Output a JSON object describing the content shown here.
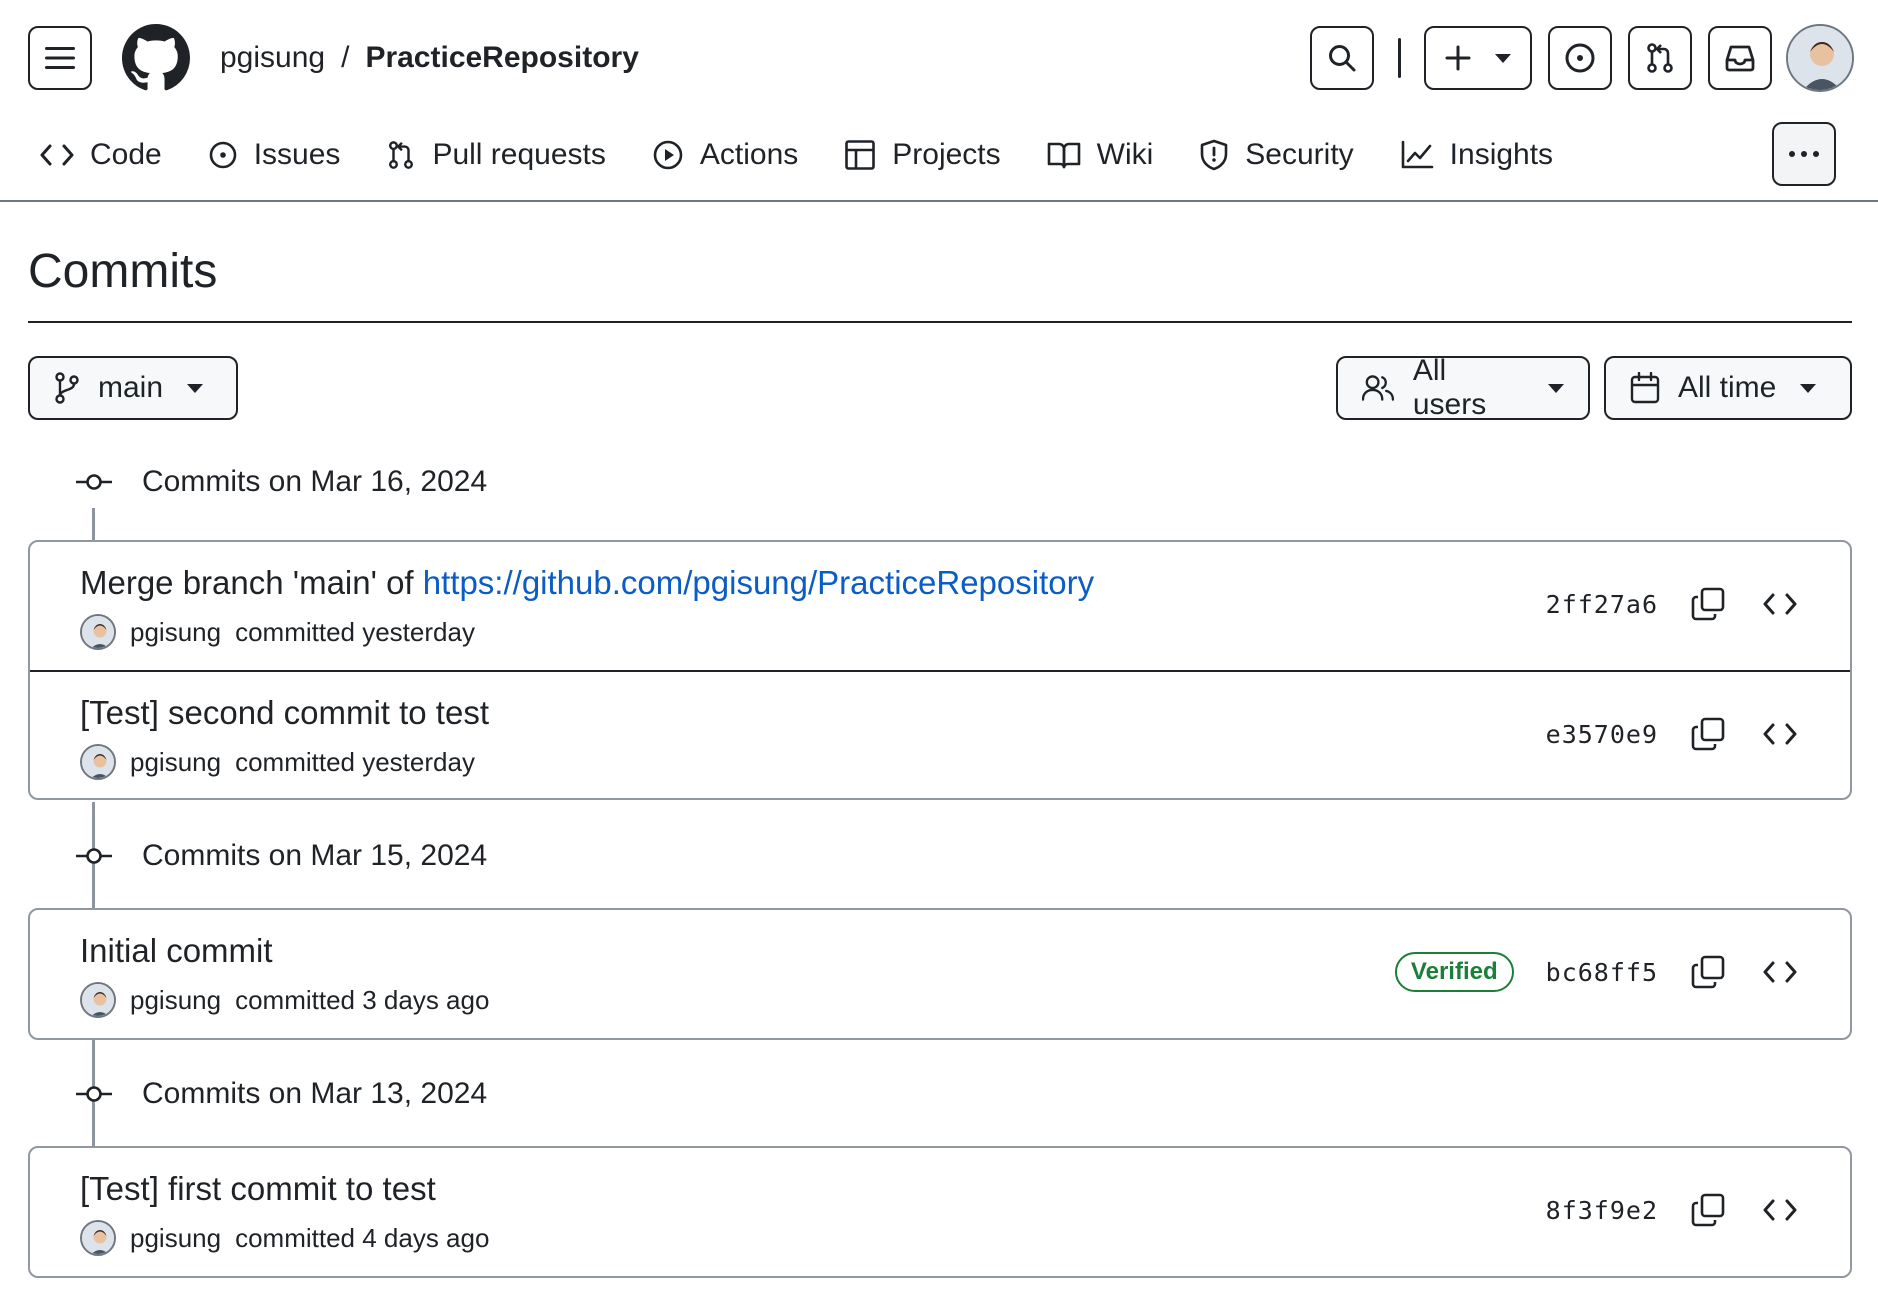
{
  "header": {
    "owner": "pgisung",
    "slash": "/",
    "repo": "PracticeRepository"
  },
  "tabs": [
    {
      "label": "Code",
      "icon": "code-icon"
    },
    {
      "label": "Issues",
      "icon": "issue-icon"
    },
    {
      "label": "Pull requests",
      "icon": "pull-request-icon"
    },
    {
      "label": "Actions",
      "icon": "play-icon"
    },
    {
      "label": "Projects",
      "icon": "table-icon"
    },
    {
      "label": "Wiki",
      "icon": "book-icon"
    },
    {
      "label": "Security",
      "icon": "shield-icon"
    },
    {
      "label": "Insights",
      "icon": "graph-icon"
    }
  ],
  "page": {
    "title": "Commits"
  },
  "toolbar": {
    "branch": "main",
    "users": "All users",
    "time": "All time"
  },
  "groups": [
    {
      "label": "Commits on Mar 16, 2024",
      "commits": [
        {
          "title_prefix": "Merge branch 'main' of ",
          "title_link": "https://github.com/pgisung/PracticeRepository",
          "author": "pgisung",
          "meta": "committed yesterday",
          "sha": "2ff27a6",
          "verified": ""
        },
        {
          "title_prefix": "[Test] second commit to test",
          "title_link": "",
          "author": "pgisung",
          "meta": "committed yesterday",
          "sha": "e3570e9",
          "verified": ""
        }
      ]
    },
    {
      "label": "Commits on Mar 15, 2024",
      "commits": [
        {
          "title_prefix": "Initial commit",
          "title_link": "",
          "author": "pgisung",
          "meta": "committed 3 days ago",
          "sha": "bc68ff5",
          "verified": "Verified"
        }
      ]
    },
    {
      "label": "Commits on Mar 13, 2024",
      "commits": [
        {
          "title_prefix": "[Test] first commit to test",
          "title_link": "",
          "author": "pgisung",
          "meta": "committed 4 days ago",
          "sha": "8f3f9e2",
          "verified": ""
        }
      ]
    }
  ],
  "colors": {
    "link": "#0b5cc4",
    "verified": "#1a7f37",
    "timeline": "#8c959f"
  }
}
